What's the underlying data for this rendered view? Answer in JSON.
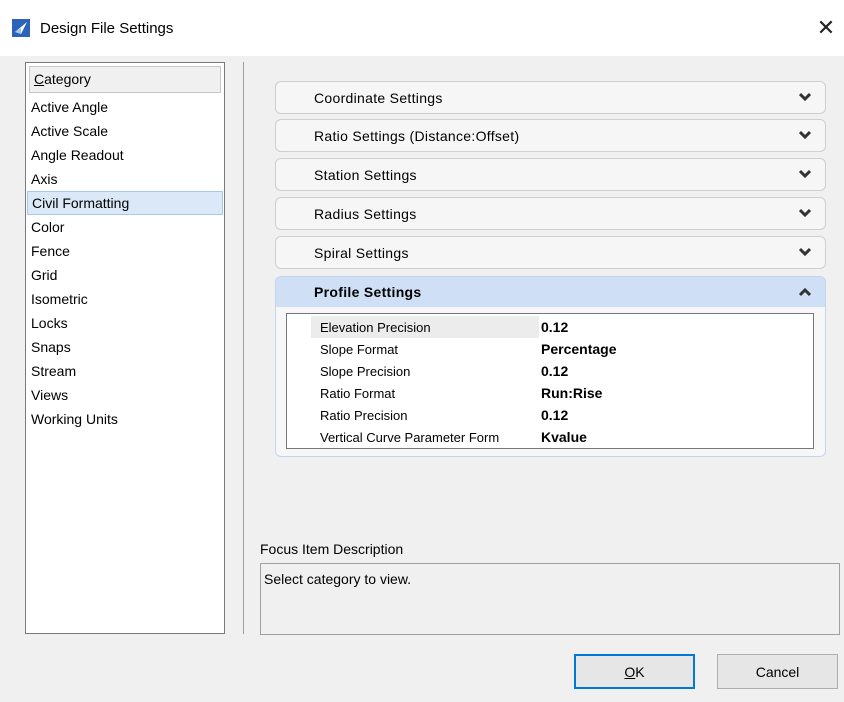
{
  "window": {
    "title": "Design File Settings",
    "close_glyph": "✕"
  },
  "category": {
    "header_access_key": "C",
    "header_rest": "ategory",
    "selected": "Civil Formatting",
    "items": [
      "Active Angle",
      "Active Scale",
      "Angle Readout",
      "Axis",
      "Civil Formatting",
      "Color",
      "Fence",
      "Grid",
      "Isometric",
      "Locks",
      "Snaps",
      "Stream",
      "Views",
      "Working Units"
    ]
  },
  "sections": {
    "coordinate": "Coordinate Settings",
    "ratio": "Ratio Settings (Distance:Offset)",
    "station": "Station Settings",
    "radius": "Radius Settings",
    "spiral": "Spiral Settings",
    "profile": "Profile Settings"
  },
  "profile_rows": [
    {
      "name": "Elevation Precision",
      "value": "0.12"
    },
    {
      "name": "Slope Format",
      "value": "Percentage"
    },
    {
      "name": "Slope Precision",
      "value": "0.12"
    },
    {
      "name": "Ratio Format",
      "value": "Run:Rise"
    },
    {
      "name": "Ratio Precision",
      "value": "0.12"
    },
    {
      "name": "Vertical Curve Parameter Form",
      "value": "Kvalue"
    }
  ],
  "focus": {
    "label": "Focus Item Description",
    "text": "Select category to view."
  },
  "buttons": {
    "ok_access_key": "O",
    "ok_rest": "K",
    "cancel": "Cancel"
  },
  "colors": {
    "selection_bg": "#dbe8f7",
    "expanded_header": "#cfe0f6",
    "default_button_border": "#0078d7"
  }
}
